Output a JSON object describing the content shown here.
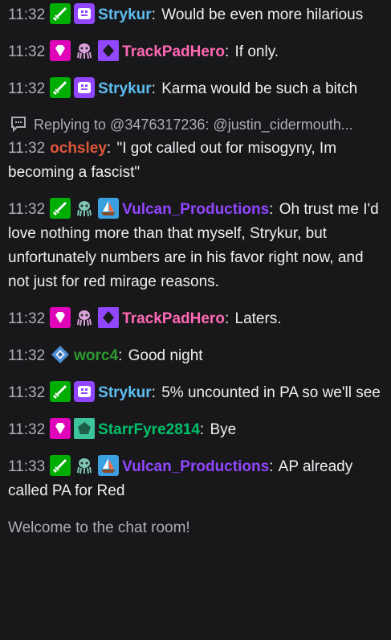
{
  "colors": {
    "background": "#18181b",
    "text": "#efeff1",
    "muted": "#adadb8",
    "strykur": "#5ebdf0",
    "trackpadhero": "#ff69b4",
    "ochsley": "#e0573b",
    "vulcan": "#9146ff",
    "worc4": "#2e9c2e",
    "starrfyre": "#00c16a"
  },
  "messages": [
    {
      "time": "11:32",
      "user": "Strykur",
      "text": "Would be even more hilarious"
    },
    {
      "time": "11:32",
      "user": "TrackPadHero",
      "text": "If only."
    },
    {
      "time": "11:32",
      "user": "Strykur",
      "text": "Karma would be such a bitch"
    },
    {
      "reply": "Replying to @3476317236: @justin_cidermouth...",
      "time": "11:32",
      "user": "ochsley",
      "text": "\"I got called out for misogyny, Im becoming a fascist\""
    },
    {
      "time": "11:32",
      "user": "Vulcan_Productions",
      "text": "Oh trust me I'd love nothing more than that myself, Strykur, but unfortunately numbers are in his favor right now, and not just for red mirage reasons."
    },
    {
      "time": "11:32",
      "user": "TrackPadHero",
      "text": "Laters."
    },
    {
      "time": "11:32",
      "user": "worc4",
      "text": "Good night"
    },
    {
      "time": "11:32",
      "user": "Strykur",
      "text": "5% uncounted in PA so we'll see"
    },
    {
      "time": "11:32",
      "user": "StarrFyre2814",
      "text": "Bye"
    },
    {
      "time": "11:33",
      "user": "Vulcan_Productions",
      "text": "AP already called PA for Red"
    }
  ],
  "welcome": "Welcome to the chat room!",
  "icons": {
    "moderator": "sword-icon",
    "purple_face": "smiley-badge-icon",
    "vip": "diamond-badge-icon",
    "squid": "squid-badge-icon",
    "purple_diamond": "purple-diamond-badge-icon",
    "boat": "sailboat-badge-icon",
    "prime": "prime-gaming-icon",
    "green_pentagon": "pentagon-badge-icon",
    "reply": "chat-bubble-icon"
  }
}
